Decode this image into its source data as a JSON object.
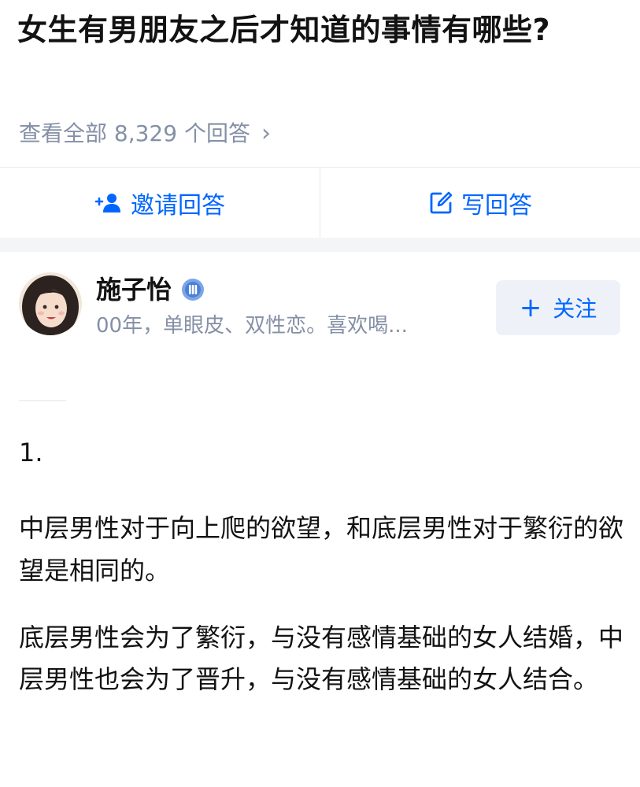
{
  "question": {
    "title": "女生有男朋友之后才知道的事情有哪些?",
    "view_all": "查看全部 8,329 个回答"
  },
  "actions": {
    "invite_label": "邀请回答",
    "write_label": "写回答",
    "invite_icon": "add-user-icon",
    "write_icon": "edit-icon",
    "accent_color": "#0066ff"
  },
  "author": {
    "name": "施子怡",
    "bio": "00年，单眼皮、双性恋。喜欢喝...",
    "follow_label": "关注",
    "badge_icon": "verified-badge-icon"
  },
  "answer": {
    "number": "1.",
    "paragraphs": [
      "中层男性对于向上爬的欲望，和底层男性对于繁衍的欲望是相同的。",
      "底层男性会为了繁衍，与没有感情基础的女人结婚，中层男性也会为了晋升，与没有感情基础的女人结合。"
    ]
  }
}
